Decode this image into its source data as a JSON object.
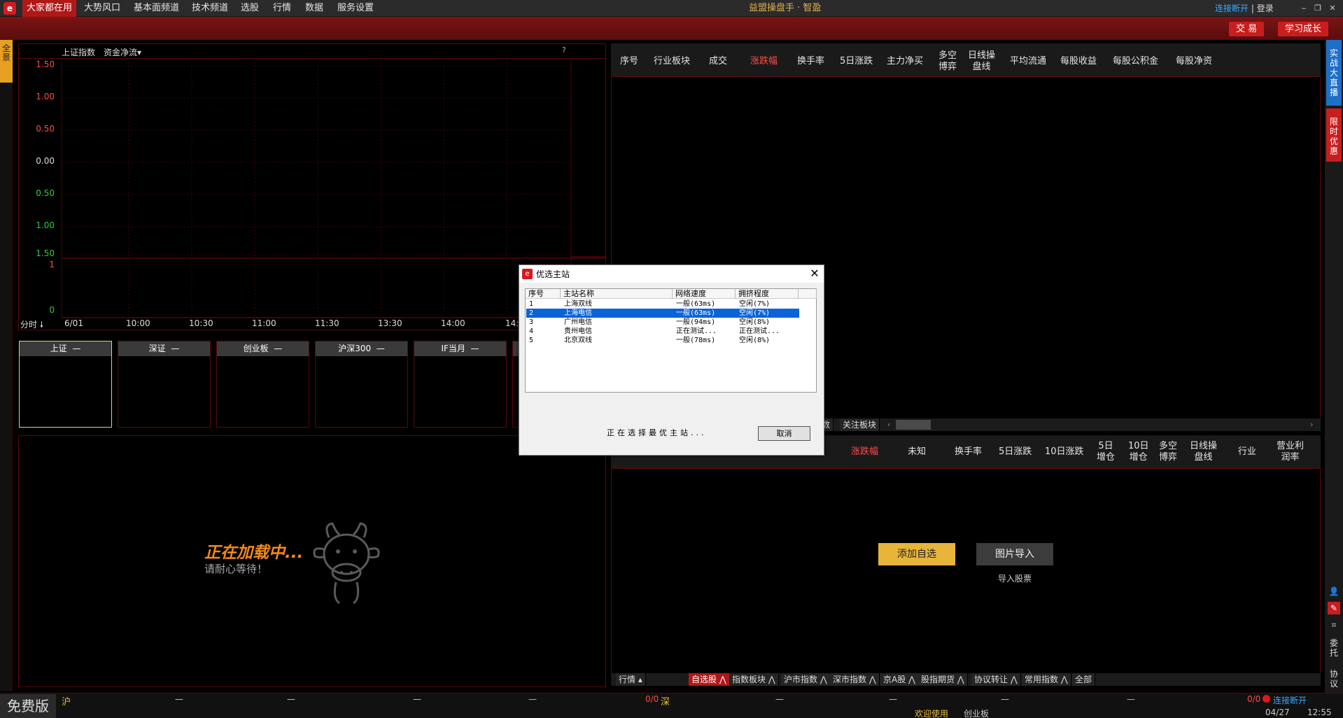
{
  "menu": {
    "items": [
      "大家都在用",
      "大势风口",
      "基本面频道",
      "技术频道",
      "选股",
      "行情",
      "数据",
      "服务设置"
    ],
    "active_index": 0
  },
  "app_title": "益盟操盘手 · 智盈",
  "top_right": {
    "connection": "连接断开",
    "separator": "|",
    "login": "登录"
  },
  "red_buttons": {
    "trade": "交 易",
    "learn": "学习成长"
  },
  "left_tab": "全景",
  "chart": {
    "title": "上证指数",
    "subtitle": "资金净流▾",
    "help": "?",
    "y_ticks": [
      "1.50",
      "1.00",
      "0.50",
      "0.00",
      "0.50",
      "1.00",
      "1.50"
    ],
    "y_colors": [
      "#ff4b4b",
      "#ff4b4b",
      "#ff4b4b",
      "#dddddd",
      "#2ecc40",
      "#2ecc40",
      "#2ecc40"
    ],
    "vol_ticks": [
      "1",
      "0"
    ],
    "time_mode": "分时",
    "time_labels": [
      "6/01",
      "10:00",
      "10:30",
      "11:00",
      "11:30",
      "13:30",
      "14:00",
      "14:"
    ]
  },
  "index_cards": [
    {
      "name": "上证",
      "value": "—"
    },
    {
      "name": "深证",
      "value": "—"
    },
    {
      "name": "创业板",
      "value": "—"
    },
    {
      "name": "沪深300",
      "value": "—"
    },
    {
      "name": "IF当月",
      "value": "—"
    }
  ],
  "loading": {
    "title": "正在加载中...",
    "sub": "请耐心等待！"
  },
  "top_table": {
    "columns": [
      "序号",
      "行业板块",
      "成交",
      "涨跌幅",
      "换手率",
      "5日涨跌",
      "主力净买",
      "多空\n博弈",
      "日线操\n盘线",
      "平均流通",
      "每股收益",
      "每股公积金",
      "每股净资"
    ],
    "highlight": "涨跌幅",
    "tabs": [
      "数",
      "关注板块"
    ]
  },
  "bottom_table": {
    "columns": [
      "涨跌幅",
      "未知",
      "换手率",
      "5日涨跌",
      "10日涨跌",
      "5日\n增仓",
      "10日\n增仓",
      "多空\n博弈",
      "日线操\n盘线",
      "行业",
      "营业利\n润率"
    ],
    "highlight": "涨跌幅",
    "buttons": {
      "add": "添加自选",
      "import": "图片导入",
      "import_label": "导入股票"
    },
    "tabs": [
      "行情 ▴",
      "自选股 ⋀",
      "指数板块 ⋀",
      "沪市指数 ⋀",
      "深市指数 ⋀",
      "京A股 ⋀",
      "股指期货 ⋀",
      "协议转让 ⋀",
      "常用指数 ⋀",
      "全部"
    ]
  },
  "right_strip": {
    "live": "实战大直播",
    "promo": "限时优惠",
    "entrust": "委托",
    "protocol": "协议"
  },
  "status_bar": {
    "edition": "免费版",
    "sh": "沪",
    "sz": "深",
    "dash": "—",
    "ratio": "0/0",
    "conn": "连接断开",
    "welcome": "欢迎使用",
    "board": "创业板",
    "date": "04/27",
    "time": "12:55"
  },
  "dialog": {
    "title": "优选主站",
    "close": "✕",
    "headers": [
      "序号",
      "主站名称",
      "网络速度",
      "拥挤程度"
    ],
    "rows": [
      [
        "1",
        "上海双线",
        "一般(63ms)",
        "空闲(7%)"
      ],
      [
        "2",
        "上海电信",
        "一般(63ms)",
        "空闲(7%)"
      ],
      [
        "3",
        "广州电信",
        "一般(94ms)",
        "空闲(8%)"
      ],
      [
        "4",
        "贵州电信",
        "正在测试...",
        "正在测试..."
      ],
      [
        "5",
        "北京双线",
        "一般(78ms)",
        "空闲(8%)"
      ]
    ],
    "selected_row": 1,
    "status": "正在选择最优主站...",
    "cancel": "取消"
  }
}
